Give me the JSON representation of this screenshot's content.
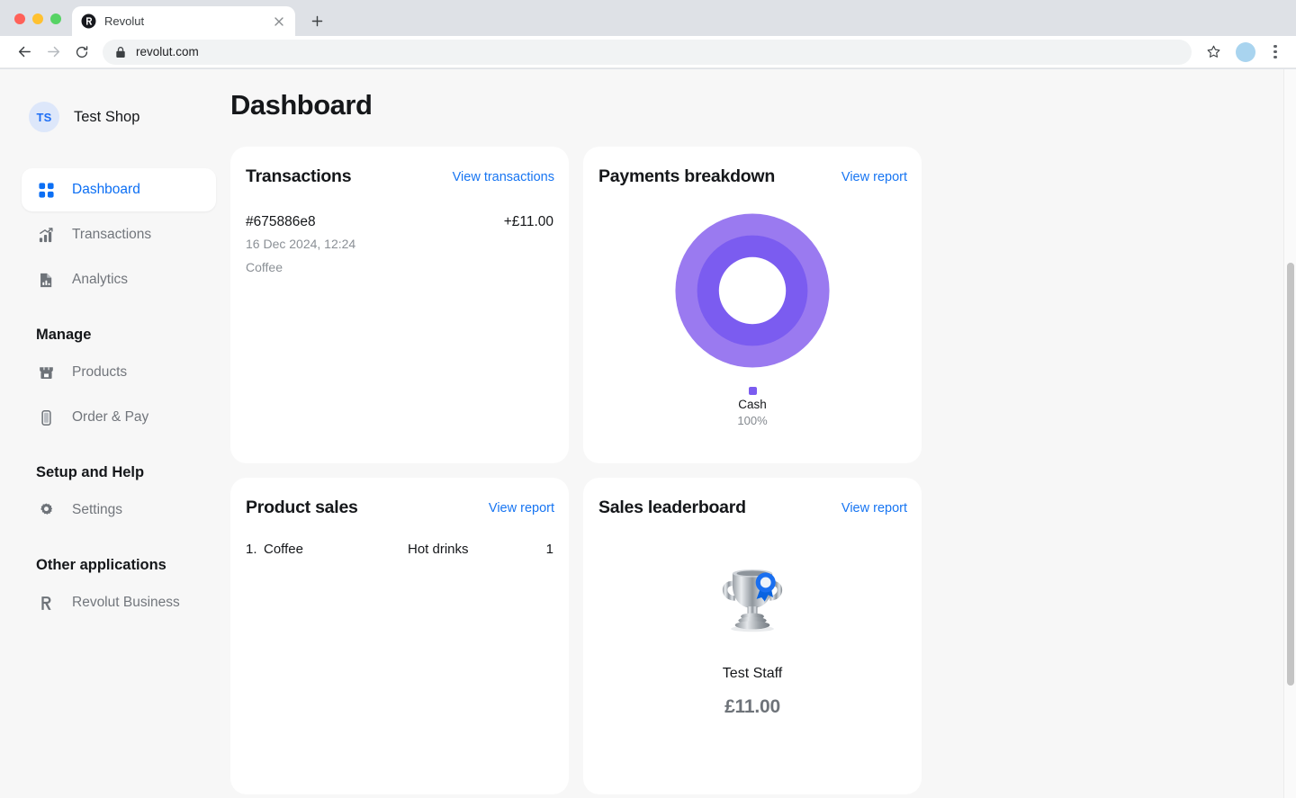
{
  "browser": {
    "tab": {
      "title": "Revolut",
      "favicon": "revolut-logo-icon",
      "close": "close-icon"
    },
    "new_tab": "+",
    "back": "back-arrow-icon",
    "forward": "forward-arrow-icon",
    "reload": "reload-icon",
    "lock": "lock-icon",
    "url": "revolut.com",
    "bookmark": "star-icon",
    "profile": "profile-avatar",
    "menu": "kebab-menu-icon"
  },
  "sidebar": {
    "shop": {
      "initials": "TS",
      "name": "Test Shop"
    },
    "items": [
      {
        "label": "Dashboard",
        "icon": "grid-icon",
        "active": true
      },
      {
        "label": "Transactions",
        "icon": "bar-chart-arrow-icon",
        "active": false
      },
      {
        "label": "Analytics",
        "icon": "document-chart-icon",
        "active": false
      }
    ],
    "sections": [
      {
        "title": "Manage",
        "items": [
          {
            "label": "Products",
            "icon": "storefront-icon"
          },
          {
            "label": "Order & Pay",
            "icon": "phone-icon"
          }
        ]
      },
      {
        "title": "Setup and Help",
        "items": [
          {
            "label": "Settings",
            "icon": "gear-icon"
          }
        ]
      },
      {
        "title": "Other applications",
        "items": [
          {
            "label": "Revolut Business",
            "icon": "revolut-r-icon"
          }
        ]
      }
    ]
  },
  "main": {
    "page_title": "Dashboard",
    "transactions_card": {
      "title": "Transactions",
      "link": "View transactions",
      "row": {
        "id": "#675886e8",
        "amount": "+£11.00",
        "date": "16 Dec 2024, 12:24",
        "product": "Coffee"
      }
    },
    "payments_card": {
      "title": "Payments breakdown",
      "link": "View report",
      "legend": {
        "label": "Cash",
        "value": "100%",
        "color": "#7b5cf0"
      }
    },
    "product_sales_card": {
      "title": "Product sales",
      "link": "View report",
      "rows": [
        {
          "rank": "1.",
          "name": "Coffee",
          "category": "Hot drinks",
          "quantity": "1"
        }
      ]
    },
    "leaderboard_card": {
      "title": "Sales leaderboard",
      "link": "View report",
      "icon": "trophy-icon",
      "name": "Test Staff",
      "amount": "£11.00"
    }
  },
  "chart_data": {
    "type": "pie",
    "title": "Payments breakdown",
    "categories": [
      "Cash"
    ],
    "values": [
      100
    ],
    "value_labels": [
      "100%"
    ],
    "colors": [
      "#7b5cf0"
    ],
    "outer_ring_color": "#9a7af0",
    "legend": "bottom-center",
    "donut": true
  }
}
